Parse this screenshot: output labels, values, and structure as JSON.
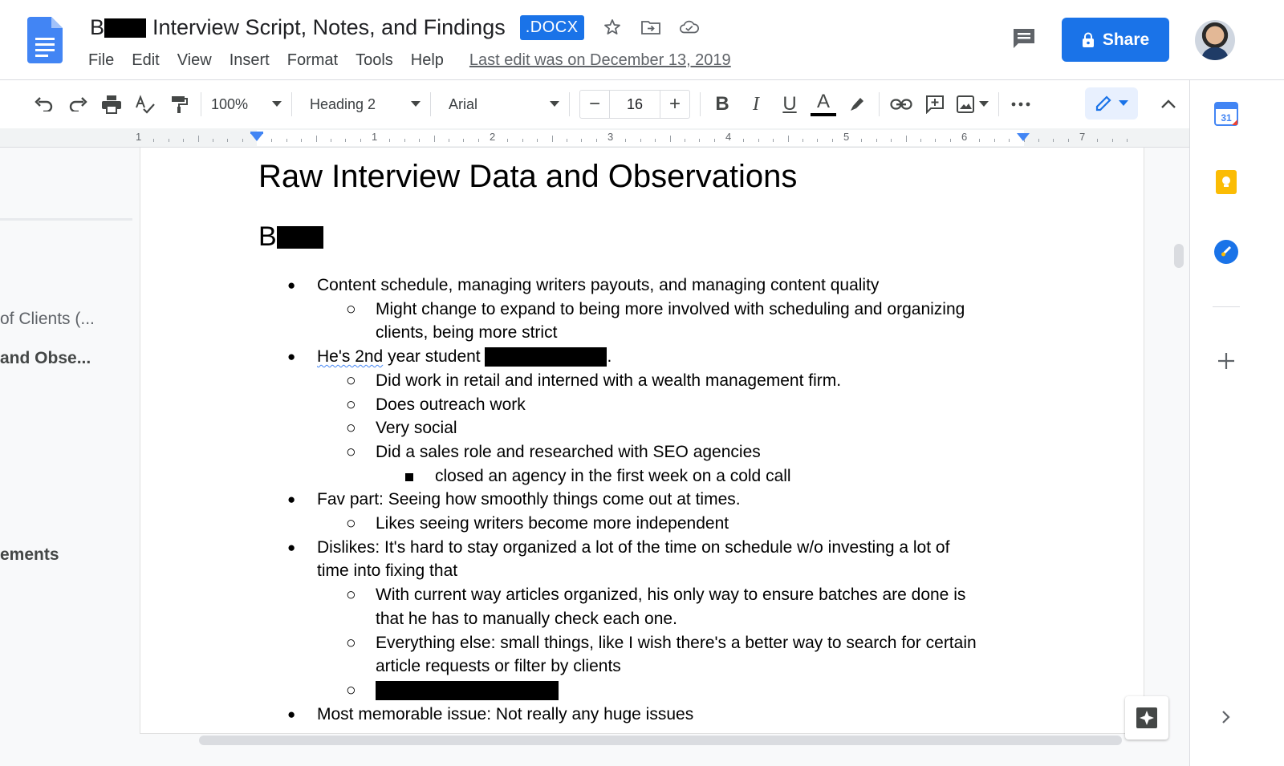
{
  "header": {
    "title_prefix": "B",
    "title": "Interview Script, Notes, and Findings",
    "badge": ".DOCX",
    "menu": [
      "File",
      "Edit",
      "View",
      "Insert",
      "Format",
      "Tools",
      "Help"
    ],
    "last_edit": "Last edit was on December 13, 2019",
    "share_label": "Share",
    "icons": [
      "docs-logo-icon",
      "star-icon",
      "move-to-folder-icon",
      "cloud-saved-icon",
      "comments-icon",
      "lock-icon"
    ]
  },
  "toolbar": {
    "zoom": "100%",
    "style": "Heading 2",
    "font": "Arial",
    "font_size": "16",
    "letters": {
      "bold": "B",
      "italic": "I",
      "underline": "U",
      "color": "A"
    },
    "text_color": "#000000"
  },
  "ruler": {
    "labels": [
      "1",
      "1",
      "2",
      "3",
      "4",
      "5",
      "6",
      "7"
    ]
  },
  "outline": {
    "items": [
      {
        "label": "of Clients (...",
        "active": false
      },
      {
        "label": "and Obse...",
        "active": true
      },
      {
        "label": "ements",
        "active": false
      }
    ]
  },
  "document": {
    "heading1": "Raw Interview Data and Observations",
    "heading2": "B",
    "lines": [
      {
        "level": 1,
        "text": "Content schedule, managing writers payouts, and managing content quality"
      },
      {
        "level": 2,
        "text": "Might change to expand to being more involved with scheduling and organizing"
      },
      {
        "level": 2,
        "cont": true,
        "text": "clients, being more strict"
      },
      {
        "level": 1,
        "text_spell": "He's 2nd",
        "text": " year student ",
        "redacted": true,
        "suffix": "."
      },
      {
        "level": 2,
        "text": "Did work in retail and interned with a wealth management firm."
      },
      {
        "level": 2,
        "text": "Does outreach work"
      },
      {
        "level": 2,
        "text": "Very social"
      },
      {
        "level": 2,
        "text": "Did a sales role and researched with SEO agencies"
      },
      {
        "level": 3,
        "text": "closed an agency in the first week on a cold call"
      },
      {
        "level": 1,
        "text": "Fav part: Seeing how smoothly things come out at times."
      },
      {
        "level": 2,
        "text": "Likes seeing writers become more independent"
      },
      {
        "level": 1,
        "text": "Dislikes: It's hard to stay organized a lot of the time on schedule w/o investing a lot of"
      },
      {
        "level": 1,
        "cont": true,
        "text": "time into fixing that"
      },
      {
        "level": 2,
        "text": "With current way articles organized, his only way to ensure batches are done is"
      },
      {
        "level": 2,
        "cont": true,
        "text": "that he has to manually check each one."
      },
      {
        "level": 2,
        "text": "Everything else: small things, like I wish there's a better way to search for certain"
      },
      {
        "level": 2,
        "cont": true,
        "text": "article requests or filter by clients"
      },
      {
        "level": 2,
        "redacted_only": true,
        "text": ""
      },
      {
        "level": 1,
        "text": "Most memorable issue: Not really any huge issues"
      }
    ]
  },
  "colors": {
    "accent": "#1a73e8",
    "calendar": "#4285f4",
    "keep": "#fbbc04",
    "tasks": "#1a73e8"
  }
}
